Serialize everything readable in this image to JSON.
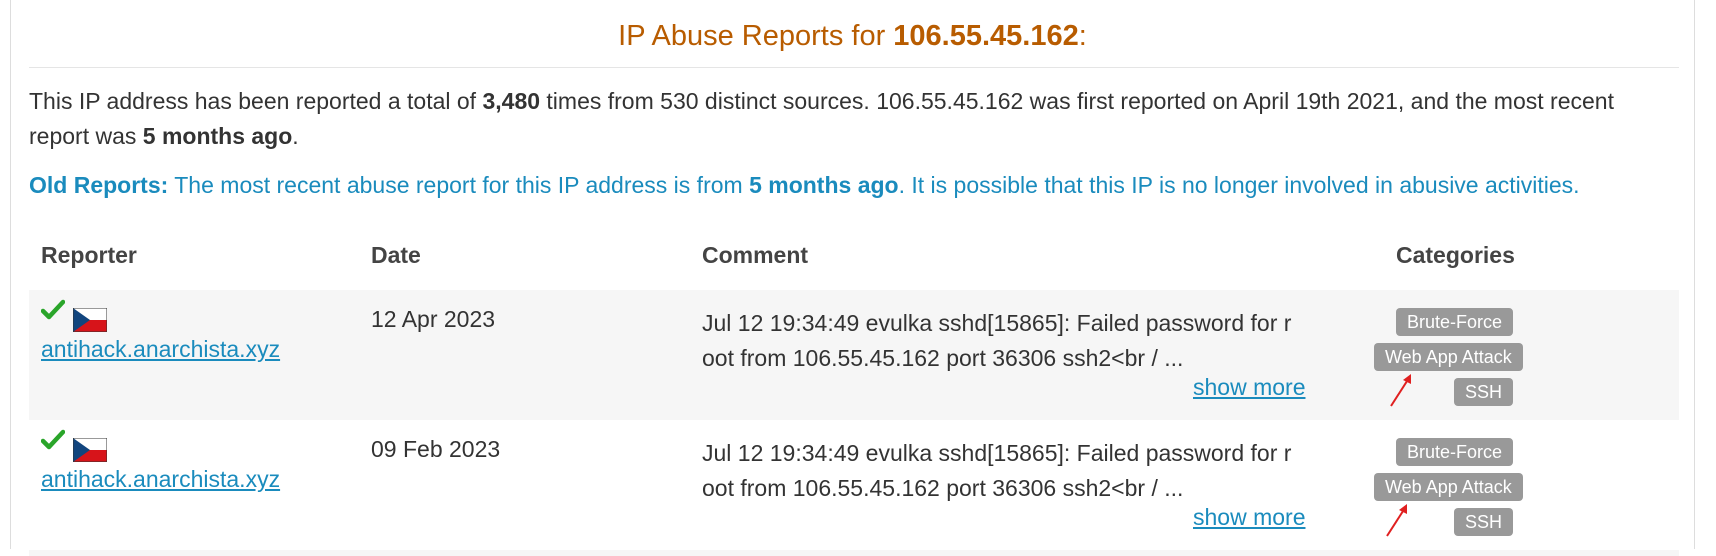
{
  "title": {
    "prefix": "IP Abuse Reports for ",
    "ip": "106.55.45.162",
    "suffix": ":"
  },
  "summary": {
    "p1": "This IP address has been reported a total of ",
    "total": "3,480",
    "p2": " times from 530 distinct sources. 106.55.45.162 was first reported on April 19th 2021, and the most recent report was ",
    "recent": "5 months ago",
    "p3": "."
  },
  "old_reports": {
    "label": "Old Reports:",
    "p1": " The most recent abuse report for this IP address is from ",
    "recent": "5 months ago",
    "p2": ". It is possible that this IP is no longer involved in abusive activities."
  },
  "table": {
    "headers": {
      "reporter": "Reporter",
      "date": "Date",
      "comment": "Comment",
      "categories": "Categories"
    },
    "rows": [
      {
        "reporter": "antihack.anarchista.xyz",
        "date": "12 Apr 2023",
        "comment": "Jul 12 19:34:49 evulka sshd[15865]: Failed password for root from 106.55.45.162 port 36306 ssh2<br / ...",
        "show_more": "show more",
        "categories": [
          "Brute-Force",
          "Web App Attack",
          "SSH"
        ]
      },
      {
        "reporter": "antihack.anarchista.xyz",
        "date": "09 Feb 2023",
        "comment": "Jul 12 19:34:49 evulka sshd[15865]: Failed password for root from 106.55.45.162 port 36306 ssh2<br / ...",
        "show_more": "show more",
        "categories": [
          "Brute-Force",
          "Web App Attack",
          "SSH"
        ]
      }
    ]
  },
  "icons": {
    "verified": "checkmark-icon",
    "flag": "czech-flag-icon",
    "annotation": "red-arrow-icon"
  },
  "colors": {
    "title": "#b85c00",
    "link": "#1a8bbd",
    "badge": "#999999",
    "check": "#2aa52a",
    "arrow": "#e02020"
  }
}
